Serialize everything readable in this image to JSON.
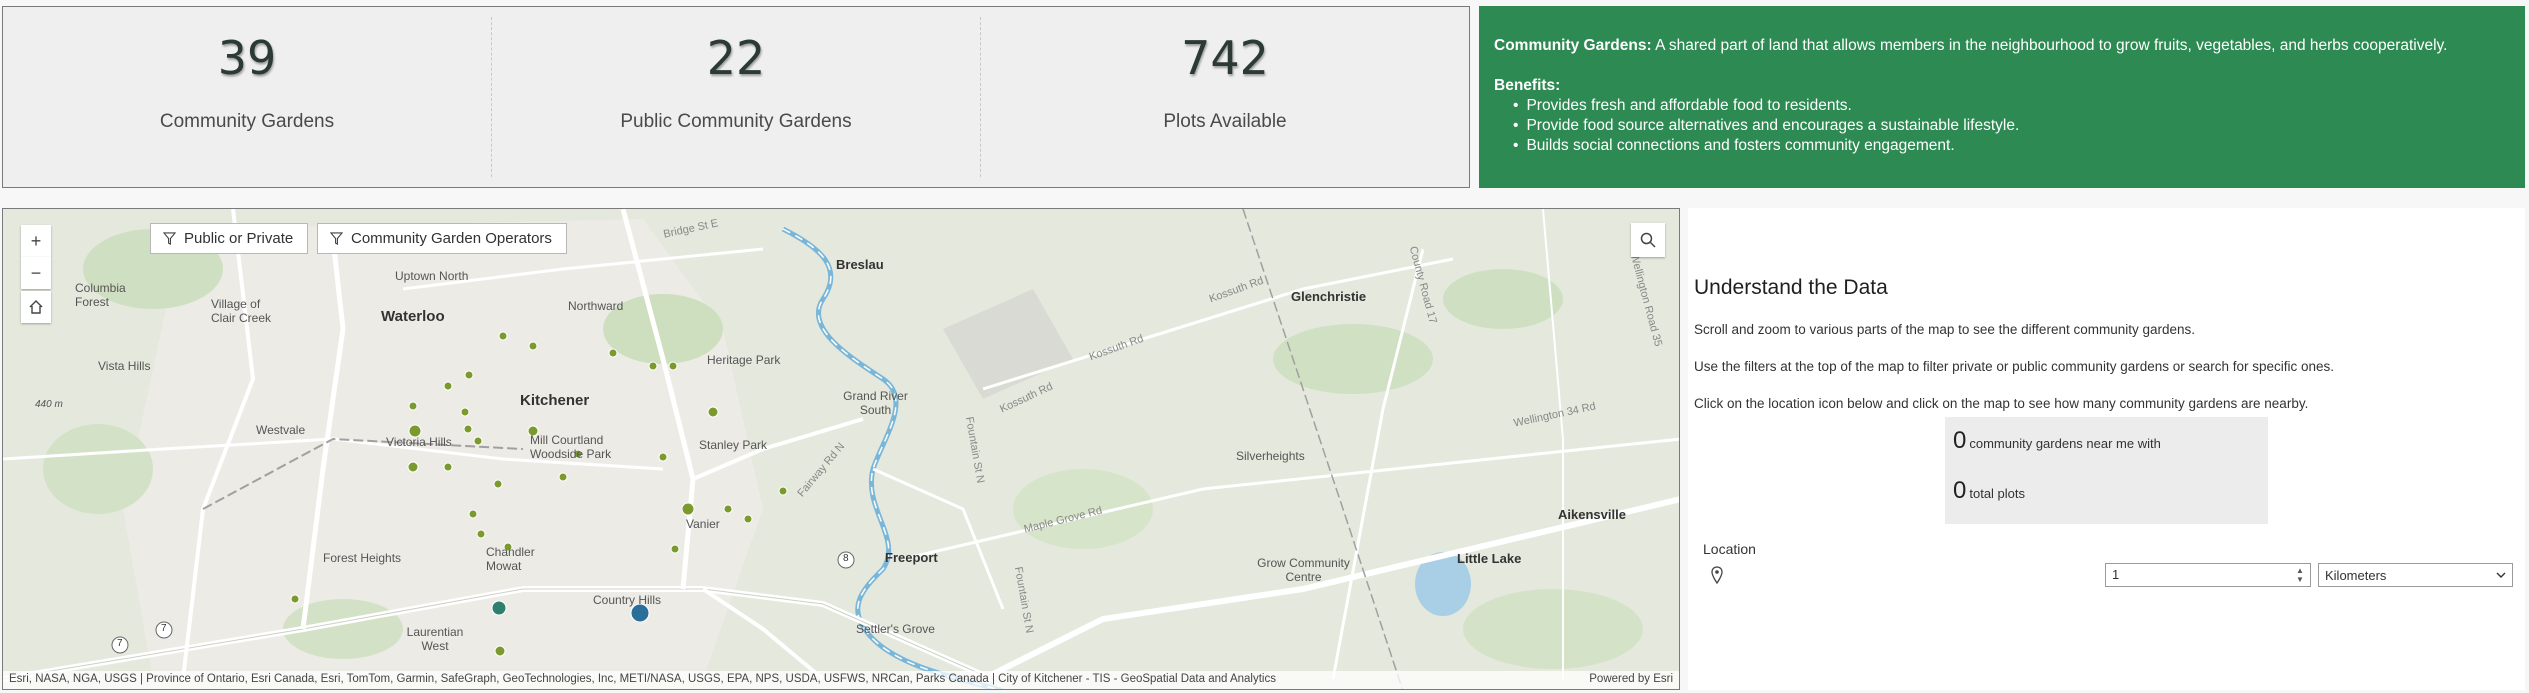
{
  "stats": [
    {
      "value": "39",
      "label": "Community Gardens"
    },
    {
      "value": "22",
      "label": "Public Community Gardens"
    },
    {
      "value": "742",
      "label": "Plots Available"
    }
  ],
  "info": {
    "title": "Community Gardens:",
    "description": "A shared part of land that allows members in the neighbourhood to grow fruits, vegetables, and herbs cooperatively.",
    "benefits_title": "Benefits:",
    "benefits": [
      "Provides fresh and affordable food to residents.",
      "Provide food source alternatives and encourages a sustainable lifestyle.",
      "Builds social connections and fosters community engagement."
    ],
    "background_color": "#2c8a52"
  },
  "map": {
    "zoom_in": "+",
    "zoom_out": "−",
    "filters": [
      "Public or Private",
      "Community Garden Operators"
    ],
    "attribution": "Esri, NASA, NGA, USGS | Province of Ontario, Esri Canada, Esri, TomTom, Garmin, SafeGraph, GeoTechnologies, Inc, METI/NASA, USGS, EPA, NPS, USDA, USFWS, NRCan, Parks Canada | City of Kitchener - TIS - GeoSpatial Data and Analytics",
    "powered_by": "Powered by Esri",
    "places": {
      "breslau": "Breslau",
      "uptown_north": "Uptown North",
      "northward": "Northward",
      "columbia_forest": "Columbia Forest",
      "village_clair_creek": "Village of Clair Creek",
      "waterloo": "Waterloo",
      "vista_hills": "Vista Hills",
      "heritage_park": "Heritage Park",
      "kitchener": "Kitchener",
      "grand_river_south": "Grand River South",
      "westvale": "Westvale",
      "victoria_hills": "Victoria Hills",
      "mill_courtland": "Mill Courtland Woodside Park",
      "stanley_park": "Stanley Park",
      "forest_heights": "Forest Heights",
      "chandler_mowat": "Chandler Mowat",
      "vanier": "Vanier",
      "freeport": "Freeport",
      "country_hills": "Country Hills",
      "laurentian_west": "Laurentian West",
      "settlers_grove": "Settler's Grove",
      "glenchristie": "Glenchristie",
      "silverheights": "Silverheights",
      "grow_community_centre": "Grow Community Centre",
      "little_lake": "Little Lake",
      "aikensville": "Aikensville",
      "elevation": "440 m"
    },
    "roads": {
      "bridge_st": "Bridge St E",
      "kossuth_rd_1": "Kossuth Rd",
      "kossuth_rd_2": "Kossuth Rd",
      "kossuth_rd_3": "Kossuth Rd",
      "fountain_st_1": "Fountain St N",
      "fountain_st_2": "Fountain St N",
      "fairway_rd": "Fairway Rd N",
      "maple_grove": "Maple Grove Rd",
      "county_rd_17": "County Road 17",
      "wellington_35": "Wellington Road 35",
      "wellington_34": "Wellington 34 Rd",
      "hwy_8": "8",
      "hwy_7a": "7",
      "hwy_7b": "7"
    }
  },
  "side": {
    "heading": "Understand the Data",
    "para1": "Scroll and zoom to various parts of the map to see the different community gardens.",
    "para2": "Use the filters at the top of the map to filter private or public community gardens or search for specific ones.",
    "para3": "Click on the location icon below and click on the map to see how many community gardens are nearby.",
    "near_count": "0",
    "near_text": "community gardens near me with",
    "plots_count": "0",
    "plots_text": "total plots",
    "location_label": "Location",
    "distance_value": "1",
    "unit_value": "Kilometers"
  }
}
